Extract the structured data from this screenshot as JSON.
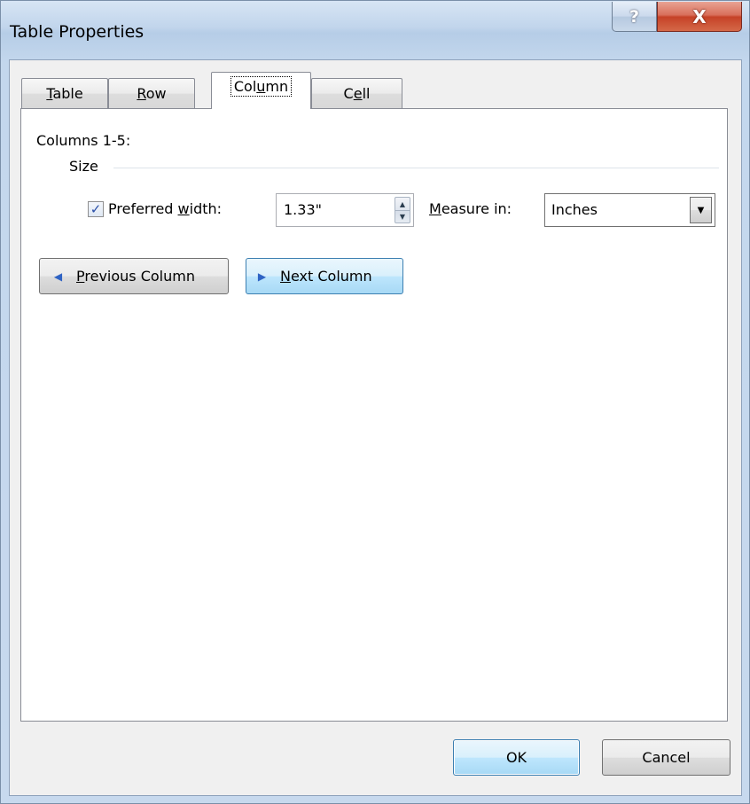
{
  "window": {
    "title": "Table Properties",
    "help_glyph": "?",
    "close_glyph": "X"
  },
  "tabs": [
    {
      "label": "Table",
      "pre": "",
      "key": "T",
      "post": "able",
      "active": false
    },
    {
      "label": "Row",
      "pre": "",
      "key": "R",
      "post": "ow",
      "active": false
    },
    {
      "label": "Column",
      "pre": "Col",
      "key": "u",
      "post": "mn",
      "active": true
    },
    {
      "label": "Cell",
      "pre": "C",
      "key": "e",
      "post": "ll",
      "active": false
    }
  ],
  "column_tab": {
    "columns_label": "Columns 1-5:",
    "size_label": "Size",
    "preferred_width": {
      "checked": true,
      "check_glyph": "✓",
      "label_pre": "Preferred ",
      "label_key": "w",
      "label_post": "idth:",
      "value": "1.33\""
    },
    "measure_in": {
      "label_pre": "",
      "label_key": "M",
      "label_post": "easure in:",
      "value": "Inches"
    },
    "previous_button": {
      "pre": "",
      "key": "P",
      "post": "revious Column"
    },
    "next_button": {
      "pre": "",
      "key": "N",
      "post": "ext Column"
    }
  },
  "footer": {
    "ok_label": "OK",
    "cancel_label": "Cancel"
  },
  "colors": {
    "accent": "#3c7fb1",
    "close_red": "#c64227",
    "panel_bg": "#ffffff",
    "dialog_bg": "#f0f0f0"
  },
  "icons": {
    "spin_up": "▲",
    "spin_down": "▼",
    "dropdown": "▼",
    "prev_arrow": "◀",
    "next_arrow": "▶"
  }
}
